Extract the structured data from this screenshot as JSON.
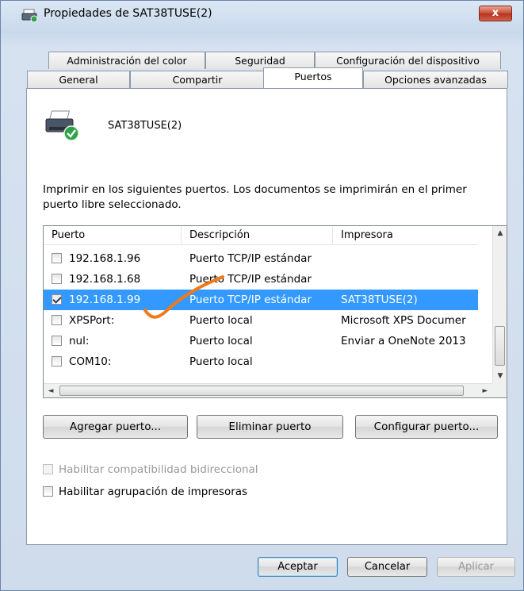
{
  "window": {
    "title": "Propiedades de SAT38TUSE(2)",
    "close_label": "x",
    "printer_icon": "printer-icon"
  },
  "tabs": {
    "row1": [
      "Administración del color",
      "Seguridad",
      "Configuración del dispositivo"
    ],
    "row2": [
      "General",
      "Compartir",
      "Puertos",
      "Opciones avanzadas"
    ],
    "active": "Puertos"
  },
  "printer": {
    "name": "SAT38TUSE(2)"
  },
  "description": "Imprimir en los siguientes puertos. Los documentos se imprimirán en el primer puerto libre seleccionado.",
  "ports_table": {
    "columns": [
      "Puerto",
      "Descripción",
      "Impresora"
    ],
    "rows": [
      {
        "checked": false,
        "port": "192.168.1.96",
        "description": "Puerto TCP/IP estándar",
        "printer": ""
      },
      {
        "checked": false,
        "port": "192.168.1.68",
        "description": "Puerto TCP/IP estándar",
        "printer": ""
      },
      {
        "checked": true,
        "port": "192.168.1.99",
        "description": "Puerto TCP/IP estándar",
        "printer": "SAT38TUSE(2)"
      },
      {
        "checked": false,
        "port": "XPSPort:",
        "description": "Puerto local",
        "printer": "Microsoft XPS Documer"
      },
      {
        "checked": false,
        "port": "nul:",
        "description": "Puerto local",
        "printer": "Enviar a OneNote 2013"
      },
      {
        "checked": false,
        "port": "COM10:",
        "description": "Puerto local",
        "printer": ""
      }
    ],
    "selected_row": 2
  },
  "actions": {
    "add_port": "Agregar puerto...",
    "delete_port": "Eliminar puerto",
    "configure_port": "Configurar puerto..."
  },
  "options": {
    "bidirectional": {
      "label": "Habilitar compatibilidad bidireccional",
      "checked": false,
      "enabled": false
    },
    "pooling": {
      "label": "Habilitar agrupación de impresoras",
      "checked": false,
      "enabled": true
    }
  },
  "footer": {
    "ok": "Aceptar",
    "cancel": "Cancelar",
    "apply": "Aplicar",
    "apply_enabled": false
  },
  "colors": {
    "selection": "#3399ff",
    "annotation_stroke": "#f07a1a"
  }
}
